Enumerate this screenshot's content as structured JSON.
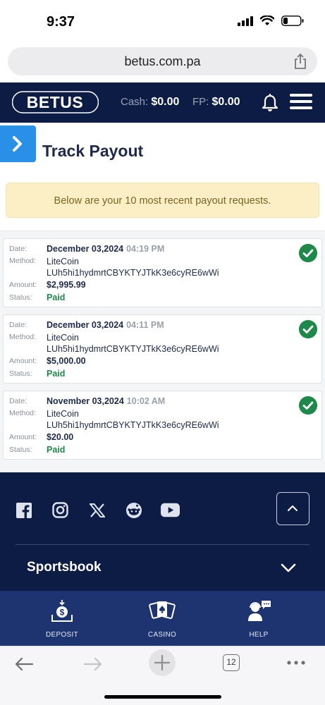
{
  "status_bar": {
    "time": "9:37"
  },
  "browser": {
    "url": "betus.com.pa",
    "tab_count": "12"
  },
  "header": {
    "logo_text": "BETUS",
    "cash_label": "Cash:",
    "cash_value": "$0.00",
    "fp_label": "FP:",
    "fp_value": "$0.00"
  },
  "page": {
    "title": "Track Payout",
    "notice": "Below are your 10 most recent payout requests."
  },
  "labels": {
    "date": "Date:",
    "method": "Method:",
    "amount": "Amount:",
    "status": "Status:"
  },
  "payouts": [
    {
      "date": "December 03,2024",
      "time": "04:19 PM",
      "method": "LiteCoin",
      "address": "LUh5hi1hydmrtCBYKTYJTkK3e6cyRE6wWi",
      "amount": "$2,995.99",
      "status": "Paid"
    },
    {
      "date": "December 03,2024",
      "time": "04:11 PM",
      "method": "LiteCoin",
      "address": "LUh5hi1hydmrtCBYKTYJTkK3e6cyRE6wWi",
      "amount": "$5,000.00",
      "status": "Paid"
    },
    {
      "date": "November 03,2024",
      "time": "10:02 AM",
      "method": "LiteCoin",
      "address": "LUh5hi1hydmrtCBYKTYJTkK3e6cyRE6wWi",
      "amount": "$20.00",
      "status": "Paid"
    }
  ],
  "footer": {
    "social": [
      "facebook-icon",
      "instagram-icon",
      "x-icon",
      "reddit-icon",
      "youtube-icon"
    ],
    "section": "Sportsbook"
  },
  "bottom_nav": {
    "deposit": "DEPOSIT",
    "casino": "CASINO",
    "help": "HELP"
  },
  "colors": {
    "navy": "#0c1c44",
    "accent_blue": "#2a8fe6",
    "paid_green": "#1e8a4a",
    "notice_bg": "#fcefc6"
  }
}
